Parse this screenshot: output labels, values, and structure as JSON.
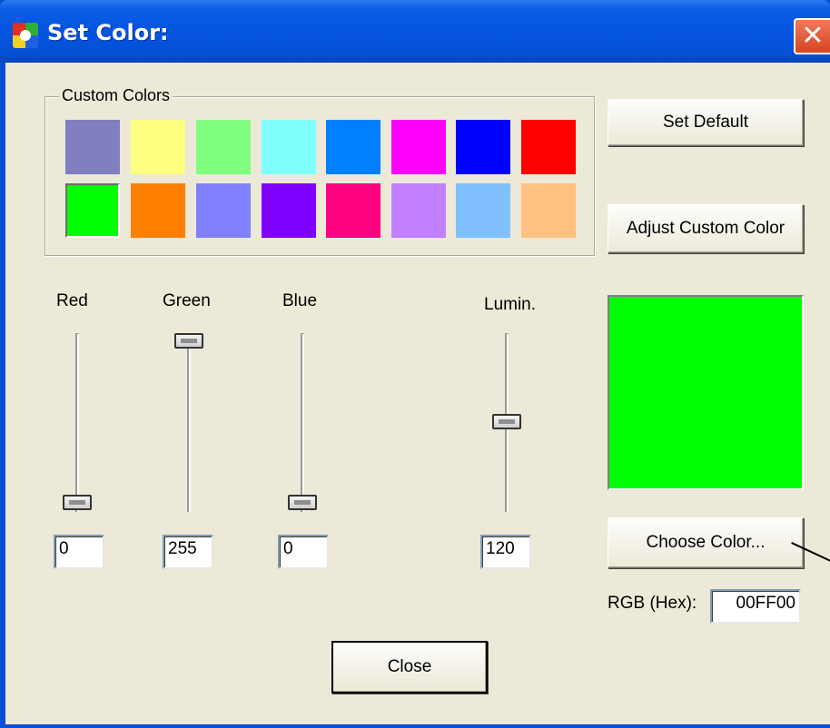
{
  "window": {
    "title": "Set Color:",
    "close_glyph": "✕"
  },
  "icons": {
    "app": "color-wheel-icon",
    "close": "close-icon"
  },
  "custom_colors": {
    "label": "Custom Colors",
    "row1": [
      "#8080c0",
      "#ffff80",
      "#80ff80",
      "#80ffff",
      "#0080ff",
      "#ff00ff",
      "#0000ff",
      "#ff0000"
    ],
    "row2": [
      "#00ff00",
      "#ff8000",
      "#8080ff",
      "#8000ff",
      "#ff0080",
      "#c080ff",
      "#80c0ff",
      "#ffc080"
    ],
    "selected": "#00ff00"
  },
  "buttons": {
    "set_default": "Set Default",
    "adjust_custom": "Adjust Custom Color",
    "choose_color": "Choose Color...",
    "close": "Close"
  },
  "sliders": {
    "red": {
      "label": "Red",
      "value": "0",
      "level": 0
    },
    "green": {
      "label": "Green",
      "value": "255",
      "level": 1
    },
    "blue": {
      "label": "Blue",
      "value": "0",
      "level": 0
    },
    "lumin": {
      "label": "Lumin.",
      "value": "120",
      "level": 0.5
    }
  },
  "preview_color": "#00ff00",
  "rgb_hex": {
    "label": "RGB (Hex):",
    "value": "00FF00"
  }
}
